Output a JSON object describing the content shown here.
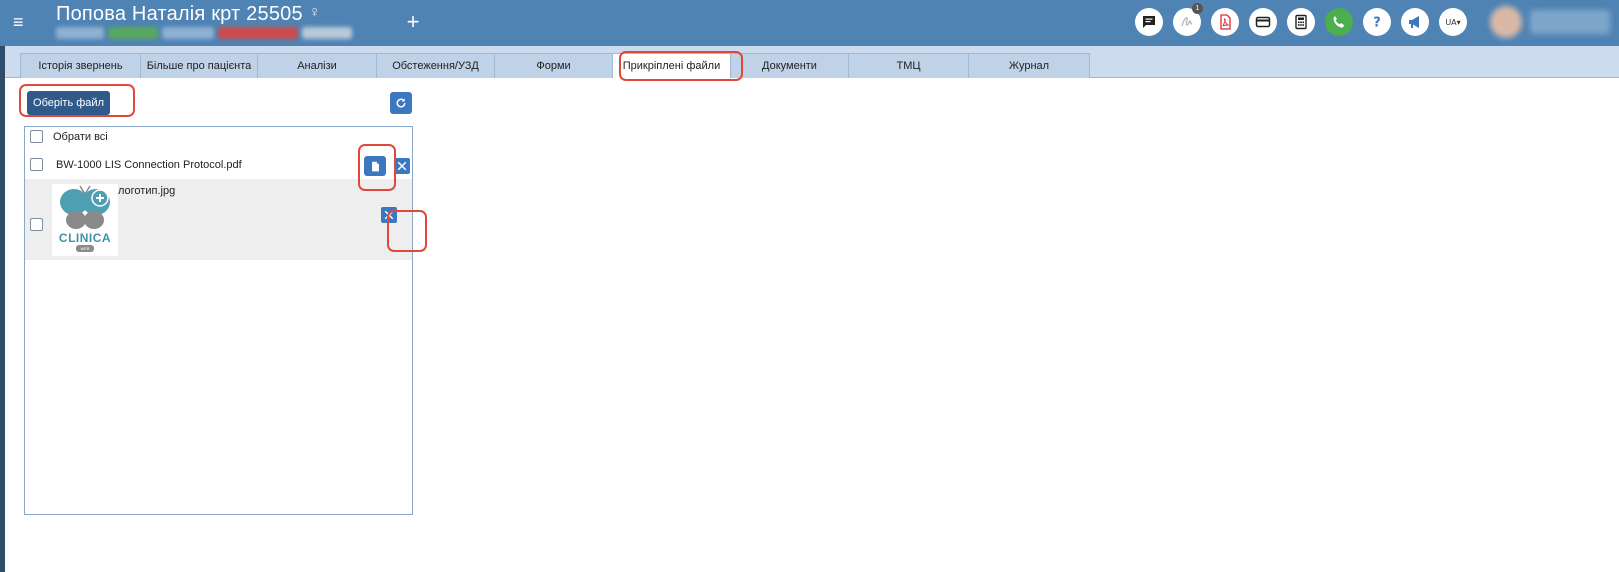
{
  "header": {
    "patient_title": "Попова Наталія крт 25505",
    "gender_symbol": "♀",
    "menu_symbol": "≡",
    "add_symbol": "+",
    "tools": [
      {
        "name": "chat-icon"
      },
      {
        "name": "signature-icon",
        "badge": "1"
      },
      {
        "name": "pdf-icon"
      },
      {
        "name": "card-icon"
      },
      {
        "name": "calculator-icon"
      },
      {
        "name": "phone-icon"
      },
      {
        "name": "help-icon"
      },
      {
        "name": "megaphone-icon"
      }
    ],
    "language": "UA",
    "colors": {
      "bar": "#4f83b4",
      "phone": "#4cae4c"
    }
  },
  "tabs": [
    {
      "label": "Історія звернень"
    },
    {
      "label": "Більше про пацієнта"
    },
    {
      "label": "Аналізи"
    },
    {
      "label": "Обстеження/УЗД"
    },
    {
      "label": "Форми"
    },
    {
      "label": "Прикріплені файли",
      "active": true
    },
    {
      "label": "Документи"
    },
    {
      "label": "ТМЦ"
    },
    {
      "label": "Журнал"
    }
  ],
  "toolbar": {
    "choose_file_label": "Оберіть файл"
  },
  "files": {
    "select_all_label": "Обрати всі",
    "items": [
      {
        "name": "BW-1000 LIS Connection Protocol.pdf",
        "type": "document"
      },
      {
        "name": "логотип.jpg",
        "type": "image",
        "thumbnail_text": "CLINICA",
        "thumbnail_sub": "WEB"
      }
    ]
  },
  "colors": {
    "highlight": "#e0483c",
    "primary_button": "#2f5a8a",
    "icon_button": "#3b78c0",
    "tab_bg": "#bfd2e8"
  }
}
